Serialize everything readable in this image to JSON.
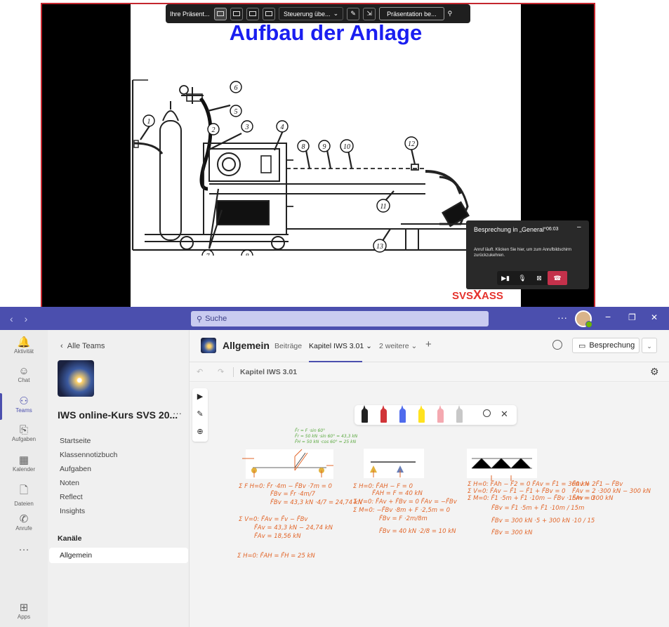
{
  "presentation": {
    "slide_title": "Aufbau der Anlage",
    "brand_left": "SVS",
    "brand_x": "X",
    "brand_right": "ASS",
    "callouts": [
      "1",
      "2",
      "3",
      "4",
      "5",
      "6",
      "7",
      "8",
      "9",
      "10",
      "11",
      "12",
      "13",
      "8",
      "7"
    ],
    "toolbar": {
      "presenter_label": "Ihre Präsent...",
      "control_label": "Steuerung übe...",
      "stop_label": "Präsentation be..."
    }
  },
  "call_popup": {
    "title": "Besprechung in „General“",
    "time": "06:03",
    "minimize": "–",
    "message": "Anruf läuft. Klicken Sie hier, um zum Anrufbildschirm zurückzukehren."
  },
  "titlebar": {
    "search_placeholder": "Suche",
    "more": "···",
    "minimize": "−",
    "maximize": "❐",
    "close": "✕"
  },
  "rail": [
    {
      "label": "Aktivität",
      "icon": "bell-icon",
      "glyph": "🔔"
    },
    {
      "label": "Chat",
      "icon": "chat-icon",
      "glyph": "☺"
    },
    {
      "label": "Teams",
      "icon": "teams-icon",
      "glyph": "⚇"
    },
    {
      "label": "Aufgaben",
      "icon": "assignments-icon",
      "glyph": "⎘"
    },
    {
      "label": "Kalender",
      "icon": "calendar-icon",
      "glyph": "▦"
    },
    {
      "label": "Dateien",
      "icon": "files-icon",
      "glyph": "🗋"
    },
    {
      "label": "Anrufe",
      "icon": "phone-icon",
      "glyph": "✆"
    },
    {
      "label": "···",
      "icon": "more-icon",
      "glyph": ""
    },
    {
      "label": "Apps",
      "icon": "apps-icon",
      "glyph": "⊞"
    }
  ],
  "panel": {
    "back_label": "Alle Teams",
    "team_name": "IWS online-Kurs SVS 20...",
    "team_more": "···",
    "links": [
      "Startseite",
      "Klassennotizbuch",
      "Aufgaben",
      "Noten",
      "Reflect",
      "Insights"
    ],
    "channels_heading": "Kanäle",
    "channel": "Allgemein"
  },
  "channel_header": {
    "name": "Allgemein",
    "tab_posts": "Beiträge",
    "tab_active": "Kapitel IWS 3.01",
    "tab_more": "2 weitere",
    "add": "+",
    "meeting_label": "Besprechung"
  },
  "whiteboard": {
    "title": "Kapitel IWS 3.01",
    "pen_colors": [
      "#222222",
      "#d13438",
      "#4f6bed",
      "#ffe21f",
      "#f4a9b0",
      "#c8c8c8"
    ],
    "accent": "#4b4fae",
    "ink_color": "#e2662a",
    "ink_blocks": [
      [
        "Σ F H=0:  F̄r ·4m − F̄Bv ·7m = 0",
        "F̄Bv = F̄r ·4m/7",
        "F̄Bv = 43,3 kN ·4/7 = 24,74 kN"
      ],
      [
        "Σ V=0:  F̄Av = F̄v − F̄Bv",
        "F̄Av = 43,3 kN − 24,74 kN",
        "F̄Av = 18,56 kN"
      ],
      [
        "Σ H=0:  F̄AH = F̄H = 25 kN"
      ],
      [
        "Σ H=0:  F̄AH − F = 0",
        "F̄AH = F = 40 kN"
      ],
      [
        "Σ V=0:  F̄Av + F̄Bv = 0   F̄Av = −F̄Bv",
        "Σ M=0:  −F̄Bv ·8m + F ·2,5m = 0"
      ],
      [
        "F̄Bv = F ·2m/8m",
        "F̄Bv = 40 kN ·2/8 = 10 kN"
      ],
      [
        "Σ H=0:  F̄Ah − F̄2 = 0   F̄Av = F̄1 = 300 kN",
        "Σ V=0:  F̄Av − F̄1 − F̄1 + F̄Bv = 0",
        "Σ M=0:  F̄1 ·5m + F̄1 ·10m − F̄Bv ·15m = 0"
      ],
      [
        "F̄Bv = F̄1 ·5m + F̄1 ·10m / 15m",
        "F̄Bv = 300 kN ·5 + 300 kN ·10 / 15",
        "F̄Bv = 300 kN"
      ],
      [
        "F̄Av = 2F̄1 − F̄Bv",
        "F̄Av = 2 ·300 kN − 300 kN",
        "F̄Av = 300 kN"
      ]
    ],
    "green_notes": [
      "F̄r = F ·sin 60°",
      "F̄r = 50 kN ·sin 60° = 43,3 kN",
      "F̄H = 50 kN ·cos 60° = 25 kN"
    ]
  }
}
